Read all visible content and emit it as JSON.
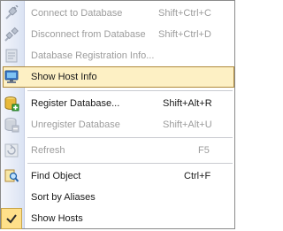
{
  "menu": {
    "connect": {
      "label": "Connect to Database",
      "shortcut": "Shift+Ctrl+C"
    },
    "disconnect": {
      "label": "Disconnect from Database",
      "shortcut": "Shift+Ctrl+D"
    },
    "db_reg_info": {
      "label": "Database Registration Info..."
    },
    "show_host_info": {
      "label": "Show Host Info"
    },
    "register_db": {
      "label": "Register Database...",
      "shortcut": "Shift+Alt+R"
    },
    "unregister_db": {
      "label": "Unregister Database",
      "shortcut": "Shift+Alt+U"
    },
    "refresh": {
      "label": "Refresh",
      "shortcut": "F5"
    },
    "find_object": {
      "label": "Find Object",
      "shortcut": "Ctrl+F"
    },
    "sort_by_aliases": {
      "label": "Sort by Aliases"
    },
    "show_hosts": {
      "label": "Show Hosts"
    }
  },
  "icons": {
    "connect": "plug-connect-icon",
    "disconnect": "plug-disconnect-icon",
    "db_reg_info": "database-info-icon",
    "show_host_info": "host-computer-icon",
    "register_db": "database-add-icon",
    "unregister_db": "database-remove-icon",
    "refresh": "refresh-icon",
    "find_object": "find-object-icon",
    "show_hosts": "checkmark-icon"
  },
  "colors": {
    "highlight": "#fdf0c4",
    "highlight_border": "#b08a3c",
    "disabled_text": "#9c9c9c"
  }
}
